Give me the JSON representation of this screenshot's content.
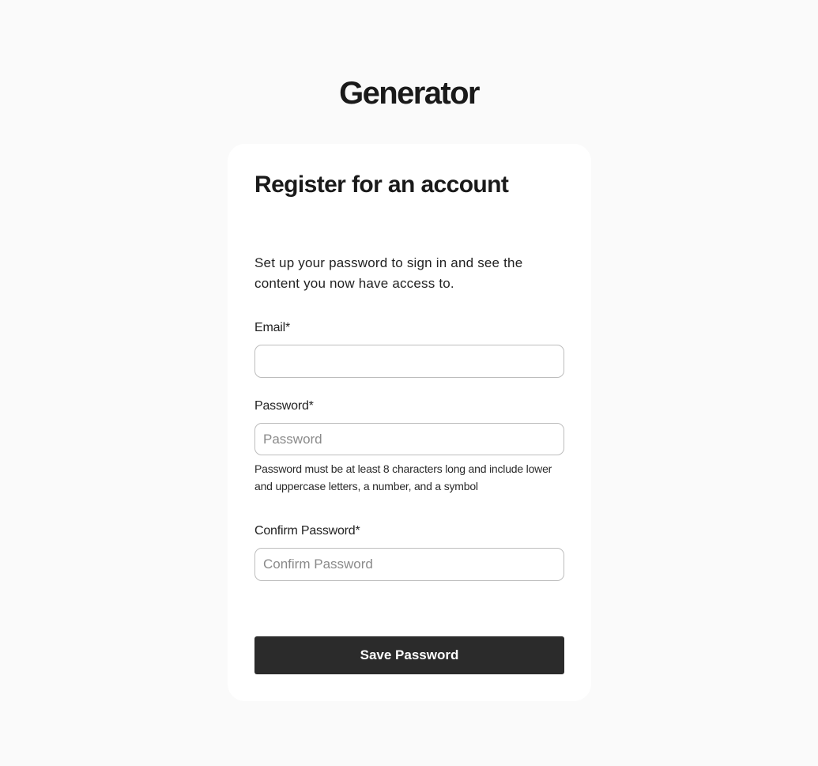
{
  "brand": {
    "logo_text": "Generator"
  },
  "form": {
    "title": "Register for an account",
    "intro": "Set up your password to sign in and see the content you now have access to.",
    "email": {
      "label": "Email*",
      "value": "",
      "placeholder": ""
    },
    "password": {
      "label": "Password*",
      "value": "",
      "placeholder": "Password",
      "help": "Password must be at least 8 characters long and include lower and uppercase letters, a number, and a symbol"
    },
    "confirm_password": {
      "label": "Confirm Password*",
      "value": "",
      "placeholder": "Confirm Password"
    },
    "submit_label": "Save Password"
  },
  "colors": {
    "background": "#fafafa",
    "card": "#ffffff",
    "button": "#2b2b2b",
    "button_text": "#ffffff",
    "input_border": "#bdbdbd"
  }
}
